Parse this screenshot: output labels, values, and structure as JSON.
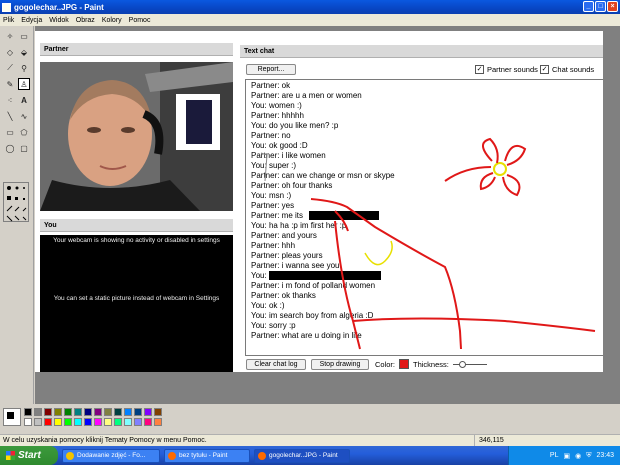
{
  "window": {
    "title": "gogolechar..JPG - Paint"
  },
  "menubar": {
    "items": [
      "Plik",
      "Edycja",
      "Widok",
      "Obraz",
      "Kolory",
      "Pomoc"
    ]
  },
  "toolbox": {
    "tools": [
      "free-select",
      "rect-select",
      "eraser",
      "fill",
      "picker",
      "magnifier",
      "pencil",
      "brush",
      "airbrush",
      "text",
      "line",
      "curve",
      "rectangle",
      "polygon",
      "ellipse",
      "rounded-rect"
    ]
  },
  "chat": {
    "partner_header": "Partner",
    "you_header": "You",
    "textchat_header": "Text chat",
    "report_label": "Report...",
    "partner_sounds_label": "Partner sounds",
    "chat_sounds_label": "Chat sounds",
    "you_msg_1": "Your webcam is showing no activity or disabled in settings",
    "you_msg_2": "You can set a static picture instead of webcam in Settings",
    "messages": [
      "Partner: ok",
      "Partner: are u a men or women",
      "You: women :)",
      "Partner: hhhhh",
      "You: do you like men? :p",
      "Partner: no",
      "You: ok good :D",
      "Partner: i like women",
      "You: super :)",
      "Partner: can we change or msn or skype",
      "Partner: oh four thanks",
      "You: msn :)",
      "Partner: yes",
      "Partner: me its",
      "You: ha ha :p im first her :p",
      "Partner: and yours",
      "Partner: hhh",
      "Partner: pleas yours",
      "Partner: i wanna see you",
      "You:",
      "Partner: i m fond of polland women",
      "Partner: ok thanks",
      "You: ok :)",
      "You: im search boy from algeria :D",
      "You: sorry :p",
      "Partner: what are u doing in life"
    ],
    "clear_label": "Clear chat log",
    "stop_label": "Stop drawing",
    "color_label": "Color:",
    "thickness_label": "Thickness:"
  },
  "palette": {
    "colors": [
      "#000000",
      "#808080",
      "#800000",
      "#808000",
      "#008000",
      "#008080",
      "#000080",
      "#800080",
      "#808040",
      "#004040",
      "#0080ff",
      "#004080",
      "#8000ff",
      "#804000",
      "#ffffff",
      "#c0c0c0",
      "#ff0000",
      "#ffff00",
      "#00ff00",
      "#00ffff",
      "#0000ff",
      "#ff00ff",
      "#ffff80",
      "#00ff80",
      "#80ffff",
      "#8080ff",
      "#ff0080",
      "#ff8040"
    ]
  },
  "status": {
    "help_text": "W celu uzyskania pomocy kliknij Tematy Pomocy w menu Pomoc.",
    "coords": "346,115"
  },
  "taskbar": {
    "start_label": "Start",
    "tasks": [
      "Dodawanie zdjęć - Fo...",
      "bez tytułu - Paint",
      "gogolechar..JPG - Paint"
    ],
    "lang": "PL",
    "clock": "23:43"
  },
  "colors": {
    "drawing": "#e01818",
    "sun": "#e8e000",
    "accent": "#245edb"
  }
}
